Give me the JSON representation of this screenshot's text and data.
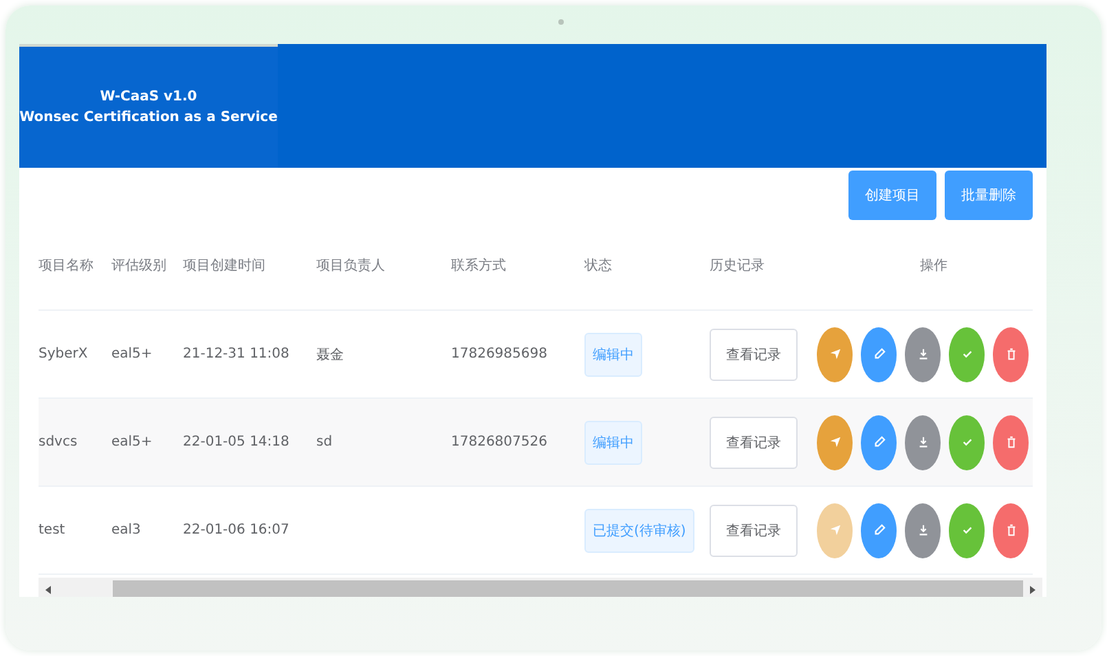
{
  "header": {
    "title": "W-CaaS v1.0",
    "subtitle": "Wonsec Certification as a Service"
  },
  "toolbar": {
    "buttons": [
      "创建项目",
      "批量删除"
    ]
  },
  "table": {
    "columns": [
      "项目名称",
      "评估级别",
      "项目创建时间",
      "项目负责人",
      "联系方式",
      "状态",
      "历史记录",
      "操作"
    ],
    "rows": [
      {
        "name": "SyberX",
        "level": "eal5+",
        "created": "21-12-31 11:08",
        "owner": "聂金",
        "phone": "17826985698",
        "status": "编辑中",
        "history": "查看记录",
        "actions": [
          {
            "kind": "send",
            "disabled": false
          },
          {
            "kind": "edit",
            "disabled": false
          },
          {
            "kind": "download",
            "disabled": false
          },
          {
            "kind": "approve",
            "disabled": false
          },
          {
            "kind": "delete",
            "disabled": false
          }
        ]
      },
      {
        "name": "sdvcs",
        "level": "eal5+",
        "created": "22-01-05 14:18",
        "owner": "sd",
        "phone": "17826807526",
        "status": "编辑中",
        "history": "查看记录",
        "actions": [
          {
            "kind": "send",
            "disabled": false
          },
          {
            "kind": "edit",
            "disabled": false
          },
          {
            "kind": "download",
            "disabled": false
          },
          {
            "kind": "approve",
            "disabled": false
          },
          {
            "kind": "delete",
            "disabled": false
          }
        ]
      },
      {
        "name": "test",
        "level": "eal3",
        "created": "22-01-06 16:07",
        "status": "已提交(待审核)",
        "history": "查看记录",
        "actions": [
          {
            "kind": "send",
            "disabled": true
          },
          {
            "kind": "edit",
            "disabled": false
          },
          {
            "kind": "download",
            "disabled": false
          },
          {
            "kind": "approve",
            "disabled": false
          },
          {
            "kind": "delete",
            "disabled": false
          }
        ]
      }
    ]
  }
}
